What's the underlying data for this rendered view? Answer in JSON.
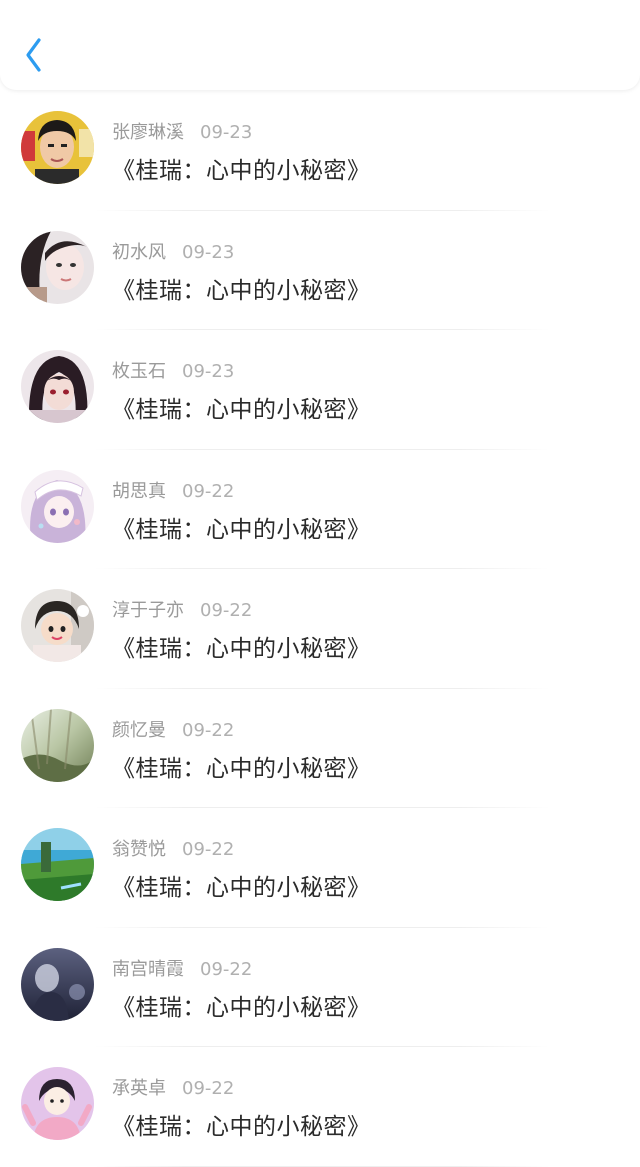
{
  "header": {
    "back_icon": "chevron-left-icon",
    "accent_color": "#2d9cf0"
  },
  "items": [
    {
      "name": "张廖琳溪",
      "date": "09-23",
      "title": "《桂瑞：心中的小秘密》"
    },
    {
      "name": "初水风",
      "date": "09-23",
      "title": "《桂瑞：心中的小秘密》"
    },
    {
      "name": "枚玉石",
      "date": "09-23",
      "title": "《桂瑞：心中的小秘密》"
    },
    {
      "name": "胡思真",
      "date": "09-22",
      "title": "《桂瑞：心中的小秘密》"
    },
    {
      "name": "淳于子亦",
      "date": "09-22",
      "title": "《桂瑞：心中的小秘密》"
    },
    {
      "name": "颜忆曼",
      "date": "09-22",
      "title": "《桂瑞：心中的小秘密》"
    },
    {
      "name": "翁赞悦",
      "date": "09-22",
      "title": "《桂瑞：心中的小秘密》"
    },
    {
      "name": "南宫晴霞",
      "date": "09-22",
      "title": "《桂瑞：心中的小秘密》"
    },
    {
      "name": "承英卓",
      "date": "09-22",
      "title": "《桂瑞：心中的小秘密》"
    }
  ]
}
